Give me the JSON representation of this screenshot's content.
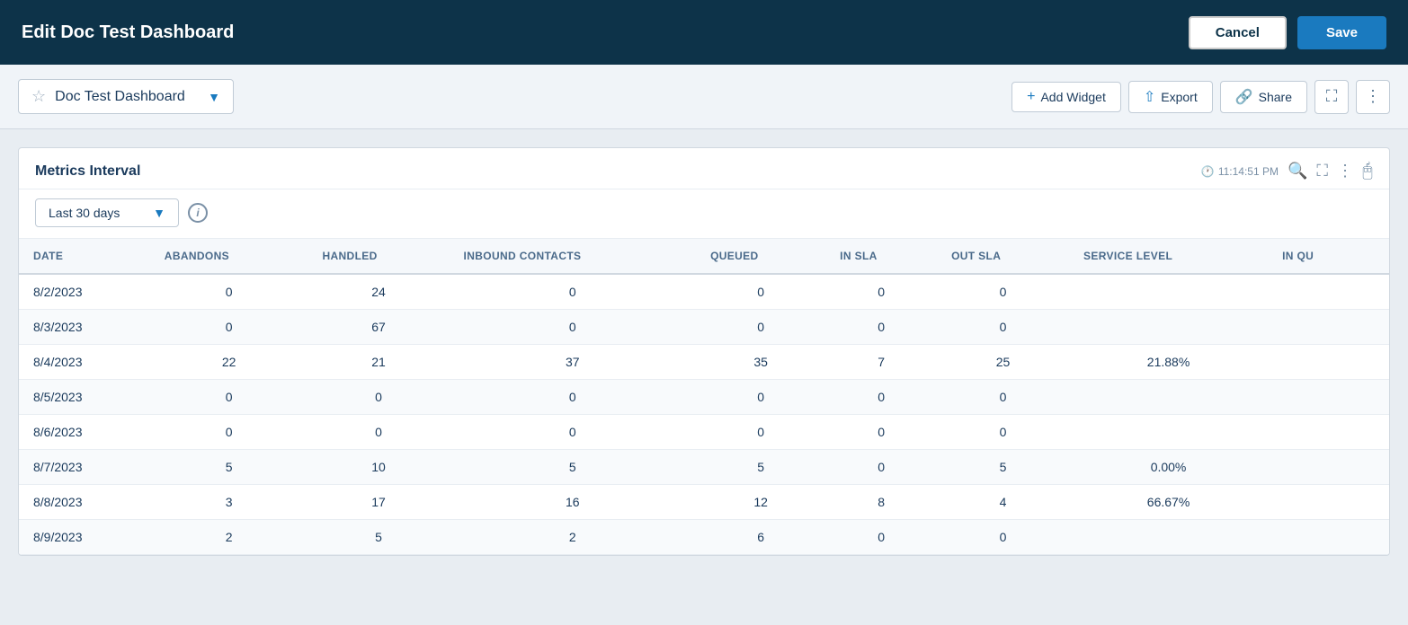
{
  "header": {
    "title": "Edit Doc Test Dashboard",
    "cancel_label": "Cancel",
    "save_label": "Save"
  },
  "subheader": {
    "dashboard_name": "Doc Test Dashboard",
    "add_widget_label": "Add Widget",
    "export_label": "Export",
    "share_label": "Share"
  },
  "widget": {
    "title": "Metrics Interval",
    "timestamp": "11:14:51 PM",
    "interval_label": "Last 30 days"
  },
  "table": {
    "columns": [
      "DATE",
      "ABANDONS",
      "HANDLED",
      "INBOUND CONTACTS",
      "QUEUED",
      "IN SLA",
      "OUT SLA",
      "SERVICE LEVEL",
      "IN QU"
    ],
    "rows": [
      {
        "date": "8/2/2023",
        "abandons": "0",
        "handled": "24",
        "inbound_contacts": "0",
        "queued": "0",
        "in_sla": "0",
        "out_sla": "0",
        "service_level": "",
        "in_qu": ""
      },
      {
        "date": "8/3/2023",
        "abandons": "0",
        "handled": "67",
        "inbound_contacts": "0",
        "queued": "0",
        "in_sla": "0",
        "out_sla": "0",
        "service_level": "",
        "in_qu": ""
      },
      {
        "date": "8/4/2023",
        "abandons": "22",
        "handled": "21",
        "inbound_contacts": "37",
        "queued": "35",
        "in_sla": "7",
        "out_sla": "25",
        "service_level": "21.88%",
        "in_qu": ""
      },
      {
        "date": "8/5/2023",
        "abandons": "0",
        "handled": "0",
        "inbound_contacts": "0",
        "queued": "0",
        "in_sla": "0",
        "out_sla": "0",
        "service_level": "",
        "in_qu": ""
      },
      {
        "date": "8/6/2023",
        "abandons": "0",
        "handled": "0",
        "inbound_contacts": "0",
        "queued": "0",
        "in_sla": "0",
        "out_sla": "0",
        "service_level": "",
        "in_qu": ""
      },
      {
        "date": "8/7/2023",
        "abandons": "5",
        "handled": "10",
        "inbound_contacts": "5",
        "queued": "5",
        "in_sla": "0",
        "out_sla": "5",
        "service_level": "0.00%",
        "in_qu": ""
      },
      {
        "date": "8/8/2023",
        "abandons": "3",
        "handled": "17",
        "inbound_contacts": "16",
        "queued": "12",
        "in_sla": "8",
        "out_sla": "4",
        "service_level": "66.67%",
        "in_qu": ""
      },
      {
        "date": "8/9/2023",
        "abandons": "2",
        "handled": "5",
        "inbound_contacts": "2",
        "queued": "6",
        "in_sla": "0",
        "out_sla": "0",
        "service_level": "",
        "in_qu": ""
      }
    ]
  }
}
